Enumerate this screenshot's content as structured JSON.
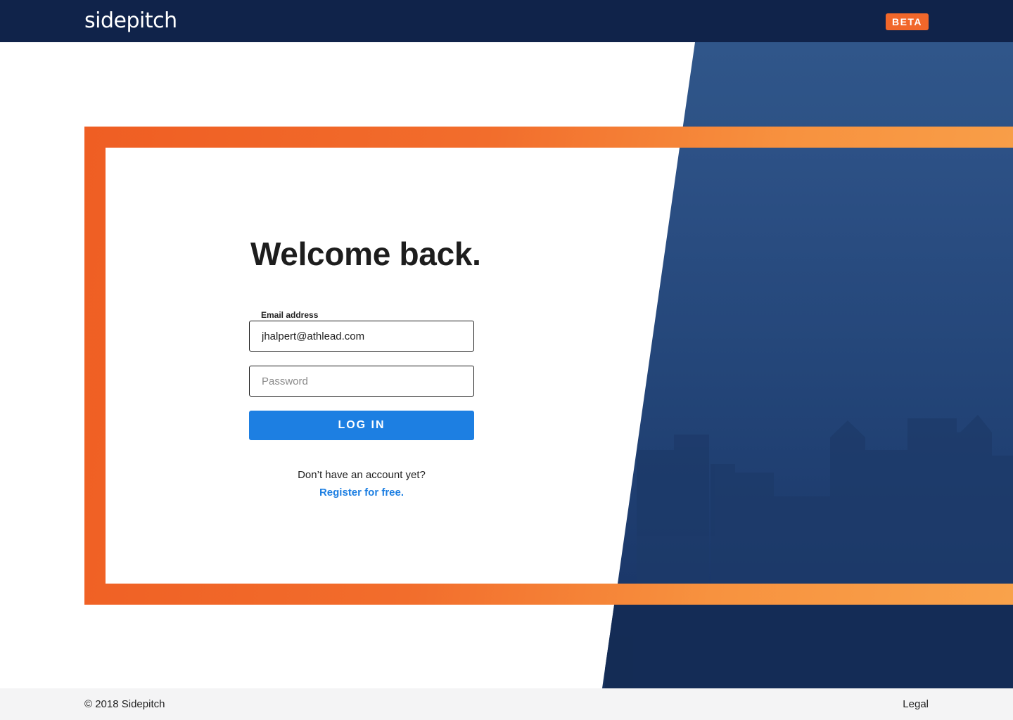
{
  "header": {
    "logo_text": "sidepitch",
    "badge": "BETA",
    "badge_color": "#f1672a",
    "bar_color": "#10234a"
  },
  "login": {
    "title": "Welcome back.",
    "email_label": "Email address",
    "email_value": "jhalpert@athlead.com",
    "password_placeholder": "Password",
    "login_button": "LOG IN",
    "no_account_text": "Don’t have an account yet?",
    "register_link": "Register for free."
  },
  "footer": {
    "copyright": "© 2018 Sidepitch",
    "legal": "Legal"
  },
  "colors": {
    "accent_orange": "#f1672a",
    "primary_blue": "#1d7fe2",
    "panel_navy": "#1e3e6e"
  }
}
